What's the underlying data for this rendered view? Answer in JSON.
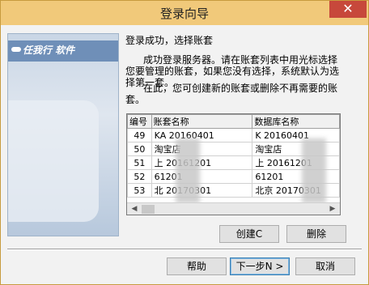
{
  "window": {
    "title": "登录向导",
    "close_label": "✕"
  },
  "sidepanel": {
    "logo_text": "任我行 软件"
  },
  "main": {
    "heading": "登录成功，选择账套",
    "desc": "成功登录服务器。请在账套列表中用光标选择您要管理的账套，如果您没有选择，系统默认为选择第一套。",
    "desc2": "在此，您可创建新的账套或删除不再需要的账套。"
  },
  "grid": {
    "columns": [
      "编号",
      "账套名称",
      "数据库名称"
    ],
    "rows": [
      {
        "id": "49",
        "name": "KA 20160401",
        "db": "K 20160401"
      },
      {
        "id": "50",
        "name": "淘宝店",
        "db": "淘宝店"
      },
      {
        "id": "51",
        "name": "上 20161201",
        "db": "上 20161201"
      },
      {
        "id": "52",
        "name": "61201",
        "db": "61201"
      },
      {
        "id": "53",
        "name": "北 20170301",
        "db": "北京 20170301"
      }
    ]
  },
  "actions": {
    "create_label": "创建C",
    "delete_label": "删除"
  },
  "footer": {
    "help_label": "帮助",
    "next_label": "下一步N >",
    "cancel_label": "取消"
  }
}
